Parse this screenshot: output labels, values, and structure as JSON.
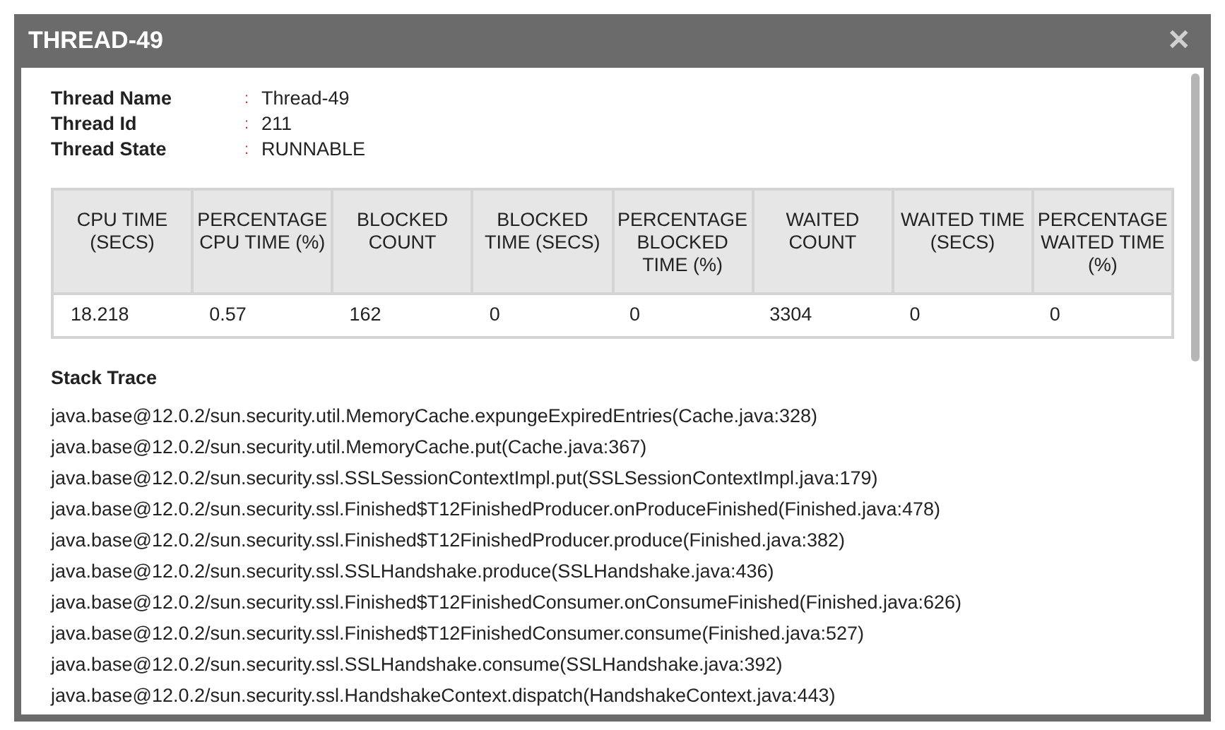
{
  "window": {
    "title": "THREAD-49",
    "close": "✕"
  },
  "info": [
    {
      "label": "Thread Name",
      "separator": ":",
      "value": "Thread-49"
    },
    {
      "label": "Thread Id",
      "separator": ":",
      "value": "211"
    },
    {
      "label": "Thread State",
      "separator": ":",
      "value": "RUNNABLE"
    }
  ],
  "table": {
    "columns": [
      "CPU TIME (SECS)",
      "PERCENTAGE CPU TIME (%)",
      "BLOCKED COUNT",
      "BLOCKED TIME (SECS)",
      "PERCENTAGE BLOCKED TIME (%)",
      "WAITED COUNT",
      "WAITED TIME (SECS)",
      "PERCENTAGE WAITED TIME (%)"
    ],
    "rows": [
      [
        "18.218",
        "0.57",
        "162",
        "0",
        "0",
        "3304",
        "0",
        "0"
      ]
    ]
  },
  "stack_trace": {
    "title": "Stack Trace",
    "lines": [
      "java.base@12.0.2/sun.security.util.MemoryCache.expungeExpiredEntries(Cache.java:328)",
      "java.base@12.0.2/sun.security.util.MemoryCache.put(Cache.java:367)",
      "java.base@12.0.2/sun.security.ssl.SSLSessionContextImpl.put(SSLSessionContextImpl.java:179)",
      "java.base@12.0.2/sun.security.ssl.Finished$T12FinishedProducer.onProduceFinished(Finished.java:478)",
      "java.base@12.0.2/sun.security.ssl.Finished$T12FinishedProducer.produce(Finished.java:382)",
      "java.base@12.0.2/sun.security.ssl.SSLHandshake.produce(SSLHandshake.java:436)",
      "java.base@12.0.2/sun.security.ssl.Finished$T12FinishedConsumer.onConsumeFinished(Finished.java:626)",
      "java.base@12.0.2/sun.security.ssl.Finished$T12FinishedConsumer.consume(Finished.java:527)",
      "java.base@12.0.2/sun.security.ssl.SSLHandshake.consume(SSLHandshake.java:392)",
      "java.base@12.0.2/sun.security.ssl.HandshakeContext.dispatch(HandshakeContext.java:443)"
    ]
  }
}
